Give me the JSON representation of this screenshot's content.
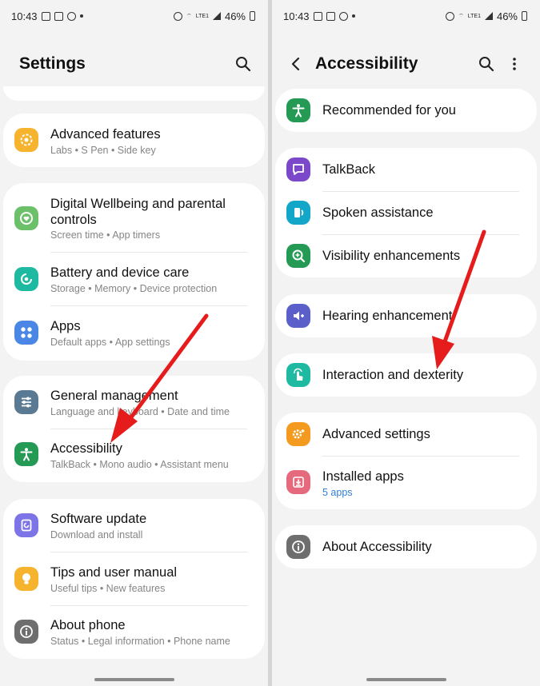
{
  "status_bar": {
    "time": "10:43",
    "battery": "46%",
    "network": "LTE1"
  },
  "left": {
    "title": "Settings",
    "items": [
      {
        "label": "Advanced features",
        "sub": "Labs  •  S Pen  •  Side key",
        "icon": "star-gear-icon",
        "color": "#f5b32e"
      },
      {
        "label": "Digital Wellbeing and parental controls",
        "sub": "Screen time  •  App timers",
        "icon": "heart-circle-icon",
        "color": "#6dc06a"
      },
      {
        "label": "Battery and device care",
        "sub": "Storage  •  Memory  •  Device protection",
        "icon": "refresh-circle-icon",
        "color": "#1eb9a1"
      },
      {
        "label": "Apps",
        "sub": "Default apps  •  App settings",
        "icon": "grid-icon",
        "color": "#4a86e6"
      },
      {
        "label": "General management",
        "sub": "Language and keyboard  •  Date and time",
        "icon": "sliders-icon",
        "color": "#5a7a94"
      },
      {
        "label": "Accessibility",
        "sub": "TalkBack  •  Mono audio  •  Assistant menu",
        "icon": "person-icon",
        "color": "#249a55"
      },
      {
        "label": "Software update",
        "sub": "Download and install",
        "icon": "update-icon",
        "color": "#7d74e8"
      },
      {
        "label": "Tips and user manual",
        "sub": "Useful tips  •  New features",
        "icon": "bulb-icon",
        "color": "#f5b32e"
      },
      {
        "label": "About phone",
        "sub": "Status  •  Legal information  •  Phone name",
        "icon": "info-icon",
        "color": "#6e6e6e"
      }
    ]
  },
  "right": {
    "title": "Accessibility",
    "items": [
      {
        "label": "Recommended for you",
        "icon": "person-star-icon",
        "color": "#249a55"
      },
      {
        "label": "TalkBack",
        "icon": "speech-bubble-icon",
        "color": "#7b48c9"
      },
      {
        "label": "Spoken assistance",
        "icon": "speaker-icon",
        "color": "#12a7c8"
      },
      {
        "label": "Visibility enhancements",
        "icon": "magnifier-icon",
        "color": "#249a55"
      },
      {
        "label": "Hearing enhancement",
        "icon": "volume-icon",
        "color": "#5b5fc9"
      },
      {
        "label": "Interaction and dexterity",
        "icon": "touch-icon",
        "color": "#1eb9a1"
      },
      {
        "label": "Advanced settings",
        "icon": "gear-plus-icon",
        "color": "#f39a1f"
      },
      {
        "label": "Installed apps",
        "sub": "5 apps",
        "icon": "download-icon",
        "color": "#e56a7e"
      },
      {
        "label": "About Accessibility",
        "icon": "info-icon",
        "color": "#6e6e6e"
      }
    ]
  }
}
